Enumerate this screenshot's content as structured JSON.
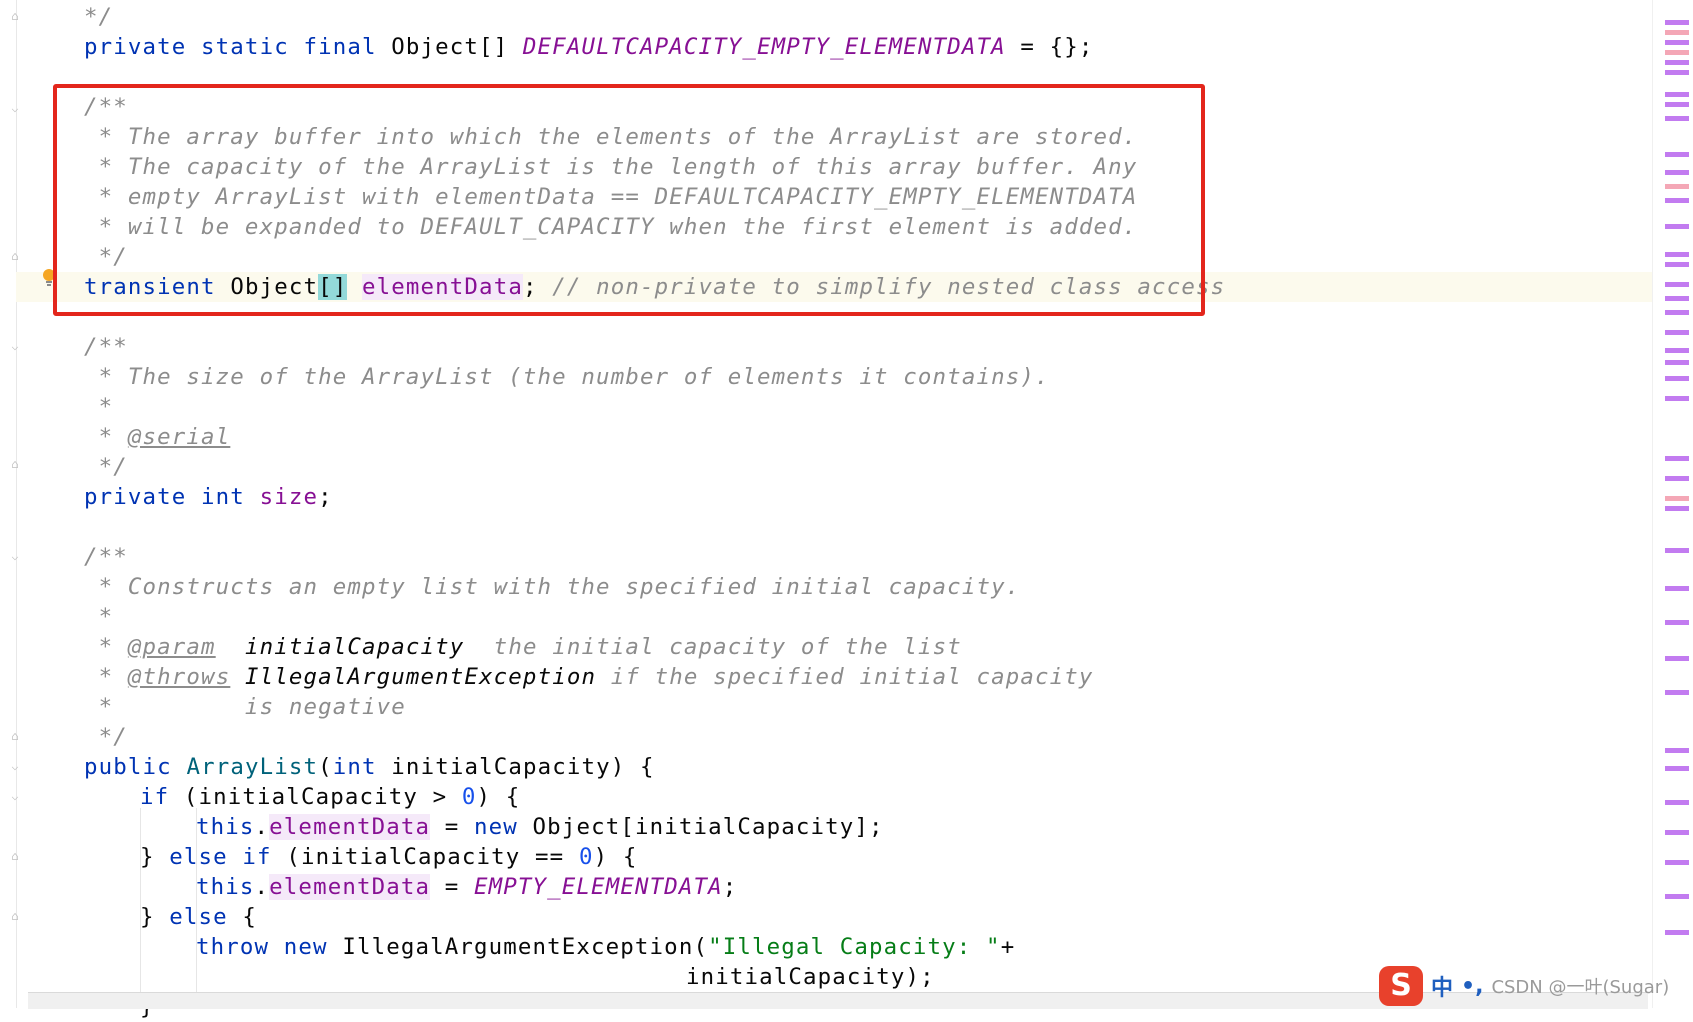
{
  "code": {
    "l1": "*/",
    "l2_a": "private static final",
    "l2_b": " Object[] ",
    "l2_c": "DEFAULTCAPACITY_EMPTY_ELEMENTDATA",
    "l2_d": " = {};",
    "l3": "/**",
    "l4": " * The array buffer into which the elements of the ArrayList are stored.",
    "l5": " * The capacity of the ArrayList is the length of this array buffer. Any",
    "l6": " * empty ArrayList with elementData == DEFAULTCAPACITY_EMPTY_ELEMENTDATA",
    "l7": " * will be expanded to DEFAULT_CAPACITY when the first element is added.",
    "l8": " */",
    "l9_a": "transient",
    "l9_b": " Object",
    "l9_c": "[]",
    "l9_d": " ",
    "l9_e": "elementData",
    "l9_f": "; ",
    "l9_g": "// non-private to simplify nested class access",
    "l10": "/**",
    "l11": " * The size of the ArrayList (the number of elements it contains).",
    "l12": " *",
    "l13_a": " * ",
    "l13_b": "@serial",
    "l14": " */",
    "l15_a": "private int",
    "l15_b": " ",
    "l15_c": "size",
    "l15_d": ";",
    "l16": "/**",
    "l17": " * Constructs an empty list with the specified initial capacity.",
    "l18": " *",
    "l19_a": " * ",
    "l19_b": "@param",
    "l19_c": "  initialCapacity",
    "l19_d": "  the initial capacity of the list",
    "l20_a": " * ",
    "l20_b": "@throws",
    "l20_c": " IllegalArgumentException",
    "l20_d": " if the specified initial capacity",
    "l21": " *         is negative",
    "l22": " */",
    "l23_a": "public",
    "l23_b": " ",
    "l23_c": "ArrayList",
    "l23_d": "(",
    "l23_e": "int",
    "l23_f": " initialCapacity) {",
    "l24_a": "if",
    "l24_b": " (initialCapacity > ",
    "l24_c": "0",
    "l24_d": ") {",
    "l25_a": "this",
    "l25_b": ".",
    "l25_c": "elementData",
    "l25_d": " = ",
    "l25_e": "new",
    "l25_f": " Object[initialCapacity];",
    "l26_a": "} ",
    "l26_b": "else if",
    "l26_c": " (initialCapacity == ",
    "l26_d": "0",
    "l26_e": ") {",
    "l27_a": "this",
    "l27_b": ".",
    "l27_c": "elementData",
    "l27_d": " = ",
    "l27_e": "EMPTY_ELEMENTDATA",
    "l27_f": ";",
    "l28_a": "} ",
    "l28_b": "else",
    "l28_c": " {",
    "l29_a": "throw new",
    "l29_b": " IllegalArgumentException(",
    "l29_c": "\"Illegal Capacity: \"",
    "l29_d": "+",
    "l30": "initialCapacity);",
    "l31": "}"
  },
  "ime": {
    "logo": "S",
    "lang": "中",
    "punct": "•,",
    "watermark": "CSDN @一叶(Sugar)"
  },
  "colors": {
    "keyword": "#0033b3",
    "field": "#871094",
    "comment": "#8c8c8c",
    "class": "#00627a",
    "number": "#1750eb",
    "string": "#067d17",
    "highlight_box": "#e3261c"
  }
}
